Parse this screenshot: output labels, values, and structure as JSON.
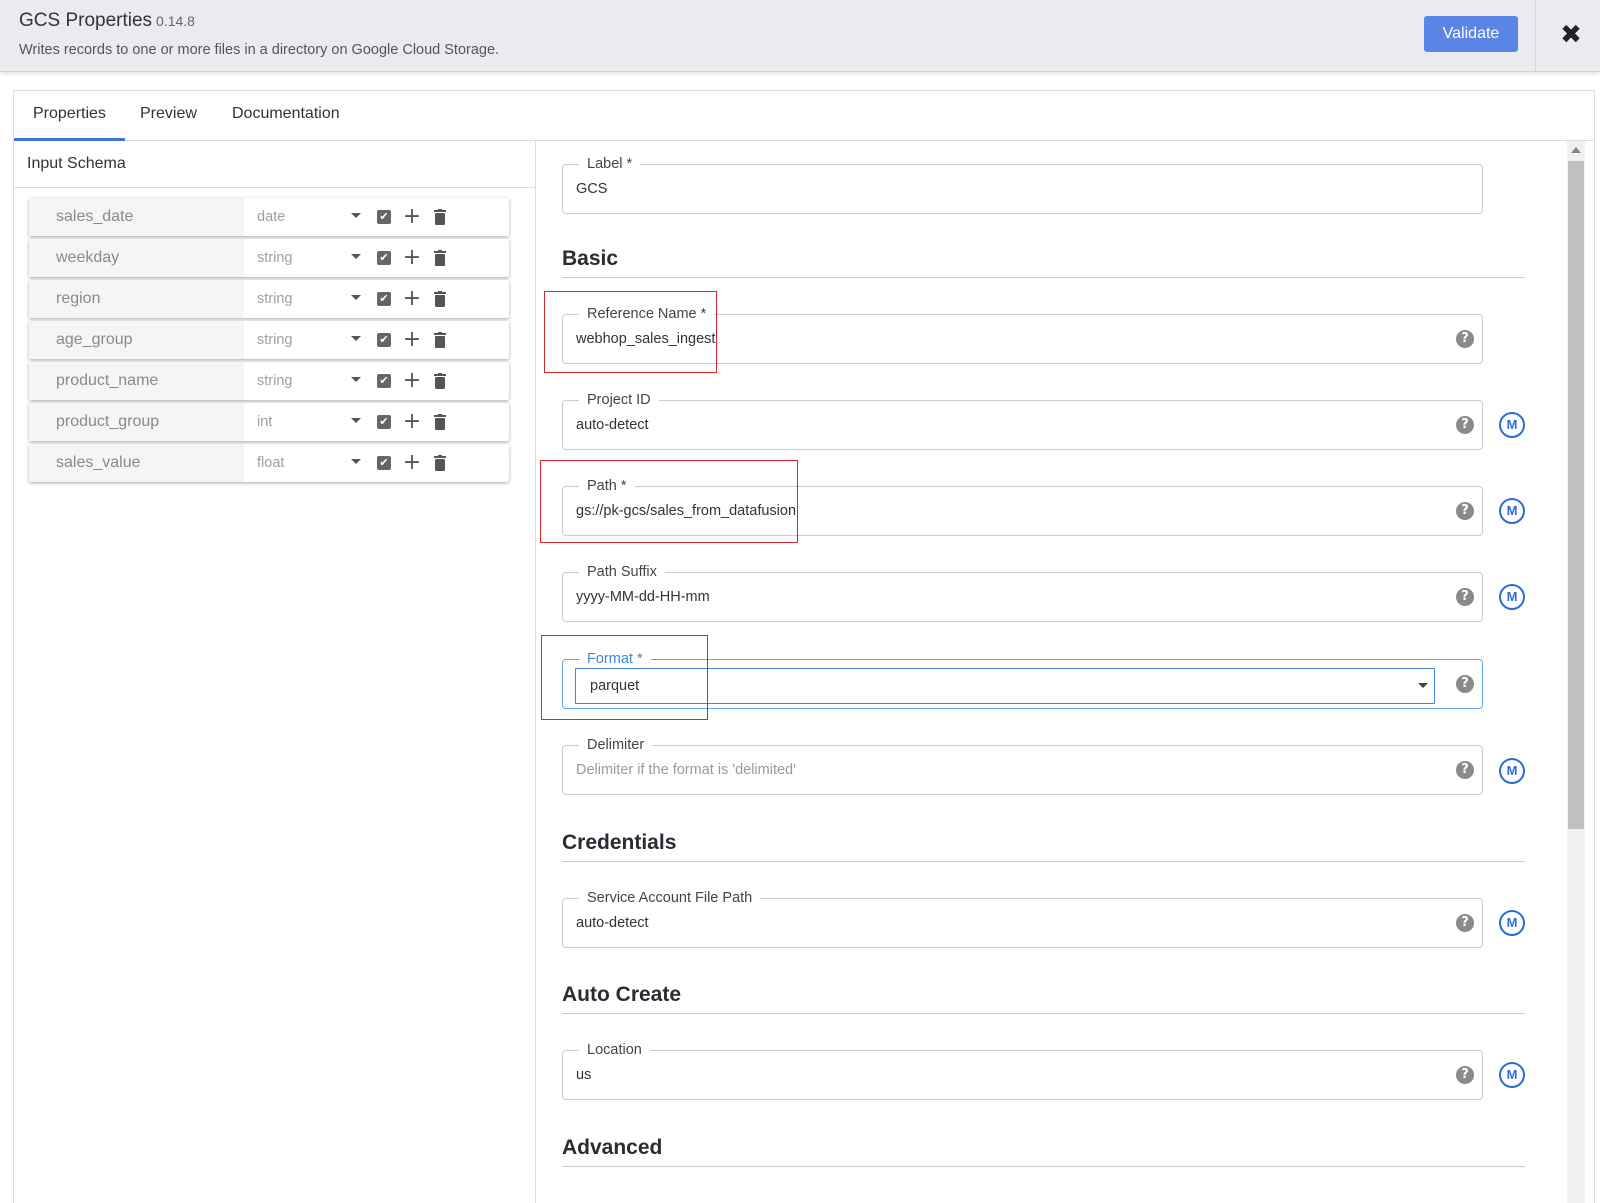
{
  "header": {
    "title": "GCS Properties",
    "version": "0.14.8",
    "description": "Writes records to one or more files in a directory on Google Cloud Storage.",
    "validate_label": "Validate",
    "close_symbol": "✖"
  },
  "tabs": [
    {
      "label": "Properties",
      "active": true
    },
    {
      "label": "Preview",
      "active": false
    },
    {
      "label": "Documentation",
      "active": false
    }
  ],
  "schema": {
    "title": "Input Schema",
    "fields": [
      {
        "name": "sales_date",
        "type": "date",
        "nullable": true
      },
      {
        "name": "weekday",
        "type": "string",
        "nullable": true
      },
      {
        "name": "region",
        "type": "string",
        "nullable": true
      },
      {
        "name": "age_group",
        "type": "string",
        "nullable": true
      },
      {
        "name": "product_name",
        "type": "string",
        "nullable": true
      },
      {
        "name": "product_group",
        "type": "int",
        "nullable": true
      },
      {
        "name": "sales_value",
        "type": "float",
        "nullable": true
      }
    ]
  },
  "icons": {
    "check": "✔",
    "plus": "+",
    "help": "?",
    "macro": "M"
  },
  "form": {
    "label": {
      "label": "Label  *",
      "value": "GCS"
    },
    "sections": {
      "basic": "Basic",
      "credentials": "Credentials",
      "auto_create": "Auto Create",
      "advanced": "Advanced"
    },
    "reference_name": {
      "label": "Reference Name  *",
      "value": "webhop_sales_ingest"
    },
    "project_id": {
      "label": "Project ID",
      "value": "auto-detect"
    },
    "path": {
      "label": "Path  *",
      "value": "gs://pk-gcs/sales_from_datafusion"
    },
    "path_suffix": {
      "label": "Path Suffix",
      "value": "yyyy-MM-dd-HH-mm"
    },
    "format": {
      "label": "Format  *",
      "value": "parquet"
    },
    "delimiter": {
      "label": "Delimiter",
      "placeholder": "Delimiter if the format is 'delimited'"
    },
    "service_account": {
      "label": "Service Account File Path",
      "value": "auto-detect"
    },
    "location": {
      "label": "Location",
      "value": "us"
    }
  },
  "colors": {
    "accent": "#5a84e6",
    "highlight_box": "#d9252a",
    "macro": "#2f6bd6"
  }
}
